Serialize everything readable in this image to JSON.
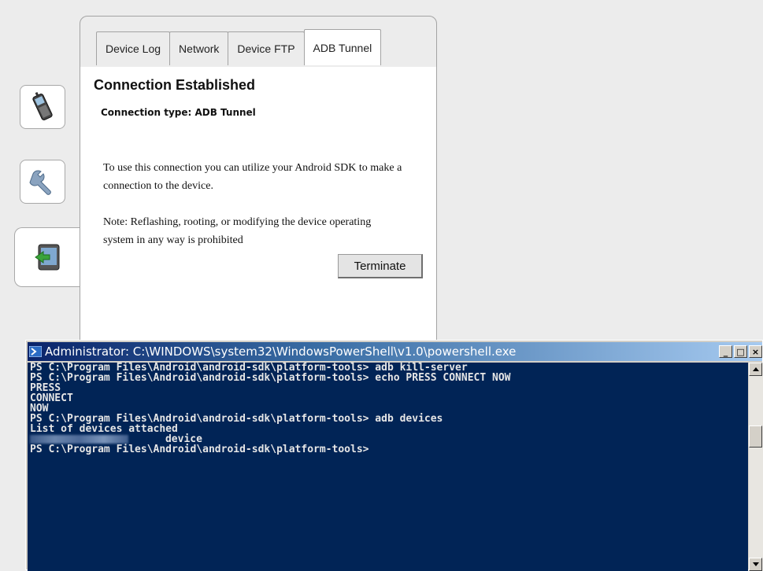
{
  "tabs": [
    {
      "label": "Device Log"
    },
    {
      "label": "Network"
    },
    {
      "label": "Device FTP"
    },
    {
      "label": "ADB Tunnel"
    }
  ],
  "side_icons": [
    "phone-icon",
    "wrench-icon",
    "device-tunnel-icon"
  ],
  "content": {
    "title": "Connection Established",
    "connection_type": "Connection type: ADB Tunnel",
    "info": "To use this connection you can utilize your Android SDK to make a connection to the device.",
    "note": "Note: Reflashing, rooting, or modifying the device operating system in any way is prohibited",
    "terminate_label": "Terminate"
  },
  "powershell": {
    "title": "Administrator: C:\\WINDOWS\\system32\\WindowsPowerShell\\v1.0\\powershell.exe",
    "lines": [
      "PS C:\\Program Files\\Android\\android-sdk\\platform-tools> adb kill-server",
      "PS C:\\Program Files\\Android\\android-sdk\\platform-tools> echo PRESS CONNECT NOW",
      "PRESS",
      "CONNECT",
      "NOW",
      "PS C:\\Program Files\\Android\\android-sdk\\platform-tools> adb devices",
      "List of devices attached",
      "device",
      "",
      "PS C:\\Program Files\\Android\\android-sdk\\platform-tools>"
    ],
    "minimize": "_",
    "maximize": "□",
    "close": "×"
  },
  "colors": {
    "console_bg": "#012456",
    "title_bar": "#0a246a"
  }
}
